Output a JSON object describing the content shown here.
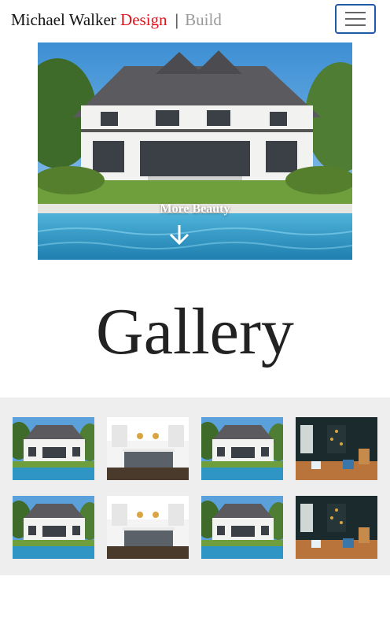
{
  "navbar": {
    "brand_name": "Michael Walker",
    "brand_design": "Design",
    "brand_separator": "|",
    "brand_build": "Build",
    "toggle_icon": "hamburger-menu-icon"
  },
  "hero": {
    "caption": "More Beauty",
    "arrow_icon": "arrow-down-icon"
  },
  "gallery": {
    "title": "Gallery",
    "items": [
      {
        "kind": "house-exterior"
      },
      {
        "kind": "kitchen"
      },
      {
        "kind": "house-exterior"
      },
      {
        "kind": "dark-den"
      },
      {
        "kind": "house-exterior"
      },
      {
        "kind": "kitchen"
      },
      {
        "kind": "house-exterior"
      },
      {
        "kind": "dark-den"
      }
    ]
  }
}
